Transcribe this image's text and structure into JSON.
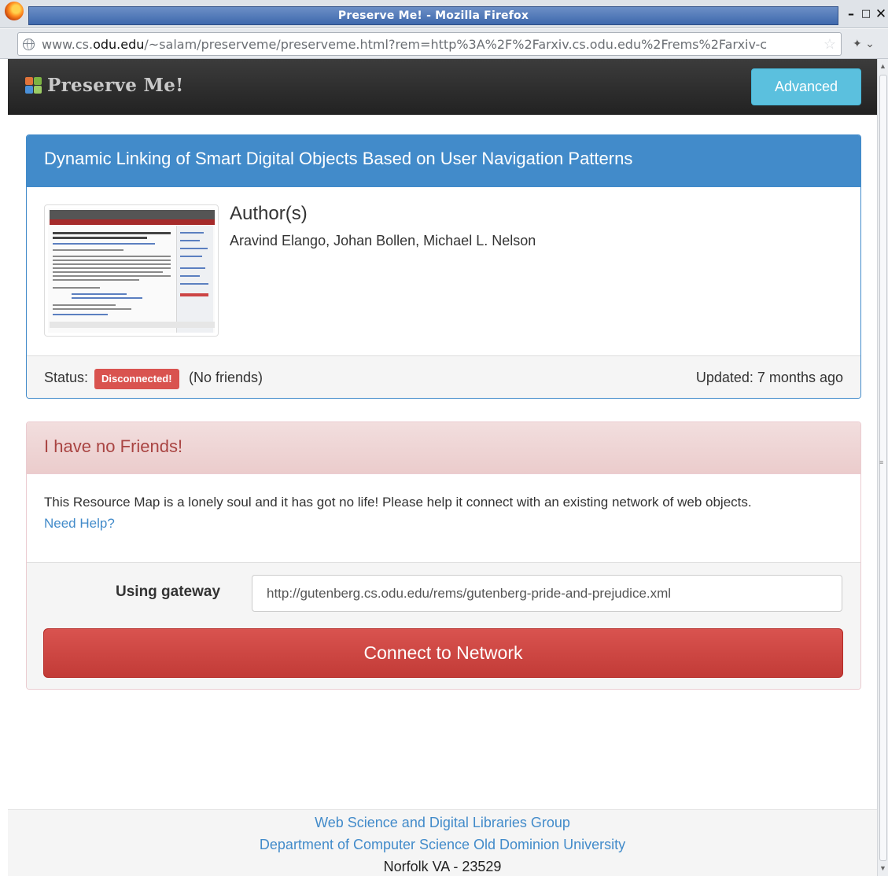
{
  "window": {
    "title": "Preserve Me! - Mozilla Firefox",
    "minimize_glyph": "–",
    "maximize_glyph": "□",
    "close_glyph": "✕"
  },
  "addressbar": {
    "url_prefix": "www.cs.",
    "url_domain": "odu.edu",
    "url_rest": "/~salam/preserveme/preserveme.html?rem=http%3A%2F%2Farxiv.cs.odu.edu%2Frems%2Farxiv-c"
  },
  "navbar": {
    "brand": "Preserve Me!",
    "advanced_label": "Advanced"
  },
  "resource_panel": {
    "title": "Dynamic Linking of Smart Digital Objects Based on User Navigation Patterns",
    "authors_heading": "Author(s)",
    "authors": "Aravind Elango, Johan Bollen, Michael L. Nelson",
    "status_label": "Status:",
    "status_badge": "Disconnected!",
    "friends_text": "(No friends)",
    "updated_text": "Updated: 7 months ago"
  },
  "friends_panel": {
    "title": "I have no Friends!",
    "message": "This Resource Map is a lonely soul and it has got no life! Please help it connect with an existing network of web objects.",
    "help_link": "Need Help?",
    "gateway_label": "Using gateway",
    "gateway_value": "http://gutenberg.cs.odu.edu/rems/gutenberg-pride-and-prejudice.xml",
    "connect_label": "Connect to Network"
  },
  "footer": {
    "line1": "Web Science and Digital Libraries Group",
    "line2": "Department of Computer Science Old Dominion University",
    "line3": "Norfolk VA - 23529"
  },
  "colors": {
    "primary": "#428bca",
    "danger": "#d9534f",
    "info": "#5bc0de",
    "navbar": "#2a2a2a"
  },
  "icons": [
    "firefox-logo-icon",
    "globe-icon",
    "bookmark-star-icon",
    "preserve-me-logo-icon"
  ]
}
